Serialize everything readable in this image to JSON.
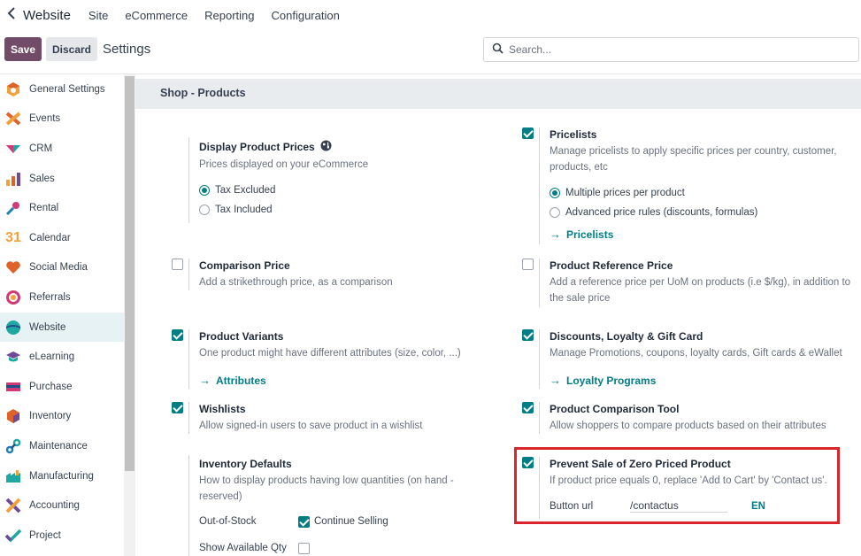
{
  "topnav": {
    "app": "Website",
    "menu": [
      "Site",
      "eCommerce",
      "Reporting",
      "Configuration"
    ]
  },
  "control": {
    "save": "Save",
    "discard": "Discard",
    "breadcrumb": "Settings",
    "search_placeholder": "Search..."
  },
  "sidebar": {
    "items": [
      {
        "label": "General Settings",
        "icon": "general-settings-icon"
      },
      {
        "label": "Events",
        "icon": "events-icon"
      },
      {
        "label": "CRM",
        "icon": "crm-icon"
      },
      {
        "label": "Sales",
        "icon": "sales-icon"
      },
      {
        "label": "Rental",
        "icon": "rental-icon"
      },
      {
        "label": "Calendar",
        "icon": "calendar-icon",
        "glyph": "31"
      },
      {
        "label": "Social Media",
        "icon": "social-media-icon"
      },
      {
        "label": "Referrals",
        "icon": "referrals-icon"
      },
      {
        "label": "Website",
        "icon": "website-icon"
      },
      {
        "label": "eLearning",
        "icon": "elearning-icon"
      },
      {
        "label": "Purchase",
        "icon": "purchase-icon"
      },
      {
        "label": "Inventory",
        "icon": "inventory-icon"
      },
      {
        "label": "Maintenance",
        "icon": "maintenance-icon"
      },
      {
        "label": "Manufacturing",
        "icon": "manufacturing-icon"
      },
      {
        "label": "Accounting",
        "icon": "accounting-icon"
      },
      {
        "label": "Project",
        "icon": "project-icon"
      }
    ],
    "active": "Website"
  },
  "section": {
    "title": "Shop - Products"
  },
  "settings": {
    "display_prices": {
      "title": "Display Product Prices",
      "desc": "Prices displayed on your eCommerce",
      "options": [
        "Tax Excluded",
        "Tax Included"
      ],
      "selected": "Tax Excluded"
    },
    "pricelists": {
      "title": "Pricelists",
      "desc": "Manage pricelists to apply specific prices per country, customer, products, etc",
      "options": [
        "Multiple prices per product",
        "Advanced price rules (discounts, formulas)"
      ],
      "selected": "Multiple prices per product",
      "link": "Pricelists",
      "checked": true
    },
    "comparison_price": {
      "title": "Comparison Price",
      "desc": "Add a strikethrough price, as a comparison",
      "checked": false
    },
    "reference_price": {
      "title": "Product Reference Price",
      "desc": "Add a reference price per UoM on products (i.e $/kg), in addition to the sale price",
      "checked": false
    },
    "variants": {
      "title": "Product Variants",
      "desc": "One product might have different attributes (size, color, ...)",
      "link": "Attributes",
      "checked": true
    },
    "loyalty": {
      "title": "Discounts, Loyalty & Gift Card",
      "desc": "Manage Promotions, coupons, loyalty cards, Gift cards & eWallet",
      "link": "Loyalty Programs",
      "checked": true
    },
    "wishlists": {
      "title": "Wishlists",
      "desc": "Allow signed-in users to save product in a wishlist",
      "checked": true
    },
    "comparison_tool": {
      "title": "Product Comparison Tool",
      "desc": "Allow shoppers to compare products based on their attributes",
      "checked": true
    },
    "inventory": {
      "title": "Inventory Defaults",
      "desc": "How to display products having low quantities (on hand - reserved)",
      "out_of_stock_label": "Out-of-Stock",
      "continue_selling": "Continue Selling",
      "continue_checked": true,
      "show_qty_label": "Show Available Qty",
      "show_qty_checked": false
    },
    "zero_price": {
      "title": "Prevent Sale of Zero Priced Product",
      "desc": "If product price equals 0, replace 'Add to Cart' by 'Contact us'.",
      "button_url_label": "Button url",
      "button_url_value": "/contactus",
      "lang": "EN",
      "checked": true
    }
  },
  "colors": {
    "primary": "#714b67",
    "accent": "#017e84",
    "highlight": "#d9252b"
  }
}
